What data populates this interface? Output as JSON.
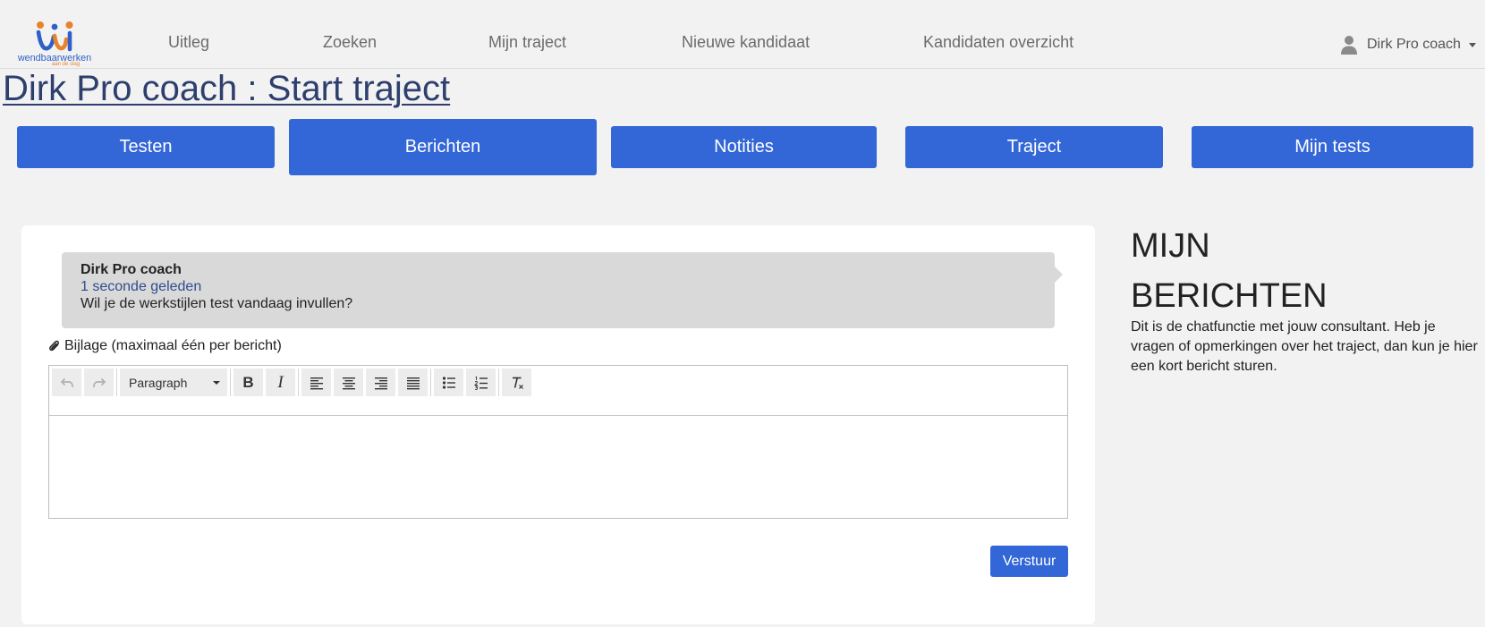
{
  "header": {
    "logo": {
      "wordmark": "wendbaarwerken",
      "tagline": "aan de slag",
      "icon": "wendbaarwerken-logo"
    },
    "nav": [
      {
        "label": "Uitleg"
      },
      {
        "label": "Zoeken"
      },
      {
        "label": "Mijn traject"
      },
      {
        "label": "Nieuwe kandidaat"
      },
      {
        "label": "Kandidaten overzicht"
      }
    ],
    "user": {
      "name": "Dirk Pro coach",
      "icon": "user-icon",
      "menu_icon": "caret-down-icon"
    }
  },
  "page": {
    "title": "Dirk Pro coach : Start traject"
  },
  "tabs": [
    {
      "label": "Testen",
      "active": false
    },
    {
      "label": "Berichten",
      "active": true
    },
    {
      "label": "Notities",
      "active": false
    },
    {
      "label": "Traject",
      "active": false
    },
    {
      "label": "Mijn tests",
      "active": false
    }
  ],
  "messages": [
    {
      "author": "Dirk Pro coach",
      "time": "1 seconde geleden",
      "text": "Wil je de werkstijlen test vandaag invullen?"
    }
  ],
  "attachment": {
    "label": "Bijlage (maximaal één per bericht)",
    "icon": "paperclip-icon"
  },
  "editor": {
    "block_format": "Paragraph",
    "block_format_icon": "caret-down-icon",
    "content": "",
    "toolbar": [
      {
        "name": "undo",
        "icon": "undo-icon",
        "enabled": false
      },
      {
        "name": "redo",
        "icon": "redo-icon",
        "enabled": false
      },
      {
        "name": "bold",
        "icon": "bold-icon",
        "glyph": "B",
        "enabled": true
      },
      {
        "name": "italic",
        "icon": "italic-icon",
        "glyph": "I",
        "enabled": true
      },
      {
        "name": "align-left",
        "icon": "align-left-icon",
        "enabled": true
      },
      {
        "name": "align-center",
        "icon": "align-center-icon",
        "enabled": true
      },
      {
        "name": "align-right",
        "icon": "align-right-icon",
        "enabled": true
      },
      {
        "name": "justify",
        "icon": "align-justify-icon",
        "enabled": true
      },
      {
        "name": "bullet-list",
        "icon": "bullet-list-icon",
        "enabled": true
      },
      {
        "name": "numbered-list",
        "icon": "numbered-list-icon",
        "enabled": true
      },
      {
        "name": "clear-formatting",
        "icon": "clear-formatting-icon",
        "enabled": true
      }
    ]
  },
  "send_button": {
    "label": "Verstuur"
  },
  "sidebar": {
    "heading": "MIJN BERICHTEN",
    "description": "Dit is de chatfunctie met jouw consultant. Heb je vragen of opmerkingen over het traject, dan kun je hier een kort bericht sturen."
  },
  "colors": {
    "primary": "#3366d6",
    "title": "#2e3f6e",
    "bubble": "#d9d9d9",
    "timestamp": "#2f4d8f",
    "background": "#f2f2f2",
    "logo_blue": "#2f5fc8",
    "logo_orange": "#e8832a"
  }
}
